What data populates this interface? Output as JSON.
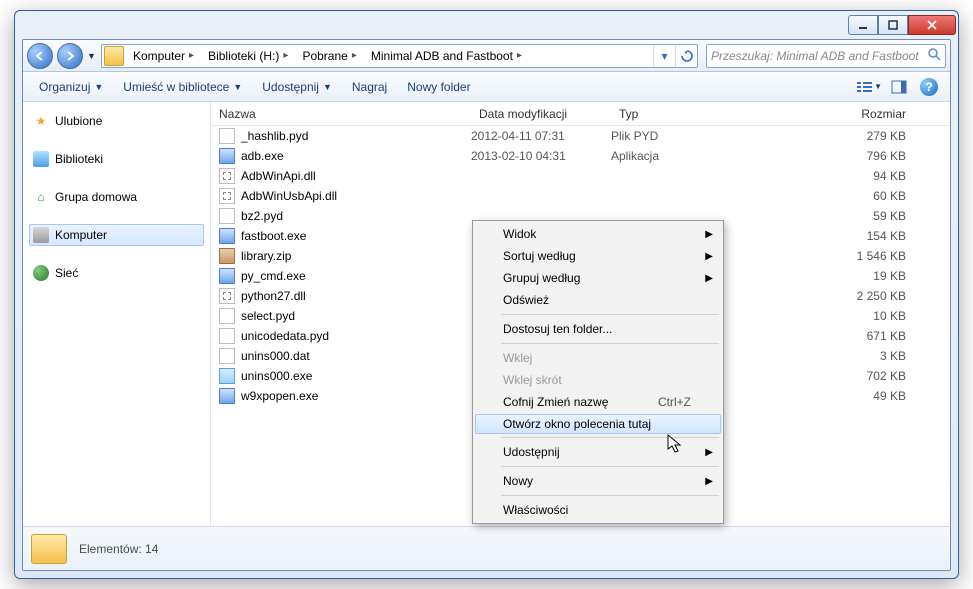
{
  "breadcrumbs": [
    "Komputer",
    "Biblioteki (H:)",
    "Pobrane",
    "Minimal ADB and Fastboot"
  ],
  "search": {
    "placeholder": "Przeszukaj: Minimal ADB and Fastboot"
  },
  "toolbar": {
    "organize": "Organizuj",
    "include": "Umieść w bibliotece",
    "share": "Udostępnij",
    "burn": "Nagraj",
    "newfolder": "Nowy folder"
  },
  "nav": {
    "fav": "Ulubione",
    "lib": "Biblioteki",
    "home": "Grupa domowa",
    "comp": "Komputer",
    "net": "Sieć"
  },
  "columns": {
    "name": "Nazwa",
    "date": "Data modyfikacji",
    "type": "Typ",
    "size": "Rozmiar"
  },
  "files": [
    {
      "name": "_hashlib.pyd",
      "date": "2012-04-11 07:31",
      "type": "Plik PYD",
      "size": "279 KB",
      "ico": "pyd"
    },
    {
      "name": "adb.exe",
      "date": "2013-02-10 04:31",
      "type": "Aplikacja",
      "size": "796 KB",
      "ico": "exe"
    },
    {
      "name": "AdbWinApi.dll",
      "date": "",
      "type": "",
      "size": "94 KB",
      "ico": "dll"
    },
    {
      "name": "AdbWinUsbApi.dll",
      "date": "",
      "type": "",
      "size": "60 KB",
      "ico": "dll"
    },
    {
      "name": "bz2.pyd",
      "date": "",
      "type": "",
      "size": "59 KB",
      "ico": "pyd"
    },
    {
      "name": "fastboot.exe",
      "date": "",
      "type": "",
      "size": "154 KB",
      "ico": "exe"
    },
    {
      "name": "library.zip",
      "date": "",
      "type": "",
      "size": "1 546 KB",
      "ico": "zip"
    },
    {
      "name": "py_cmd.exe",
      "date": "",
      "type": "",
      "size": "19 KB",
      "ico": "exe"
    },
    {
      "name": "python27.dll",
      "date": "",
      "type": "",
      "size": "2 250 KB",
      "ico": "dll"
    },
    {
      "name": "select.pyd",
      "date": "",
      "type": "",
      "size": "10 KB",
      "ico": "pyd"
    },
    {
      "name": "unicodedata.pyd",
      "date": "",
      "type": "",
      "size": "671 KB",
      "ico": "pyd"
    },
    {
      "name": "unins000.dat",
      "date": "",
      "type": "",
      "size": "3 KB",
      "ico": "dat"
    },
    {
      "name": "unins000.exe",
      "date": "",
      "type": "",
      "size": "702 KB",
      "ico": "uninst"
    },
    {
      "name": "w9xpopen.exe",
      "date": "",
      "type": "",
      "size": "49 KB",
      "ico": "exe"
    }
  ],
  "status": {
    "count": "Elementów: 14"
  },
  "ctx": {
    "view": "Widok",
    "sort": "Sortuj według",
    "group": "Grupuj według",
    "refresh": "Odśwież",
    "customize": "Dostosuj ten folder...",
    "paste": "Wklej",
    "pasteShortcut": "Wklej skrót",
    "undo": "Cofnij Zmień nazwę",
    "undoKey": "Ctrl+Z",
    "openCmd": "Otwórz okno polecenia tutaj",
    "share": "Udostępnij",
    "new": "Nowy",
    "props": "Właściwości"
  }
}
